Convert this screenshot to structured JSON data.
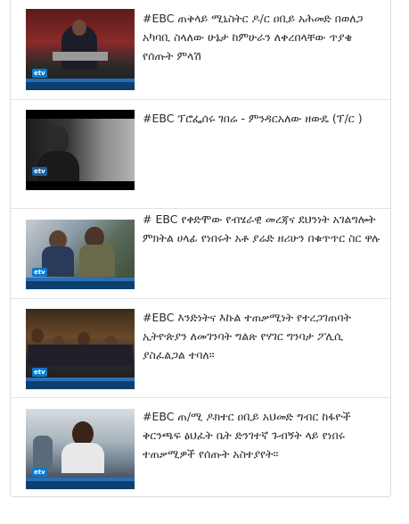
{
  "articles": [
    {
      "title": "#EBC ጠቅላይ ሚኒስትር ዶ/ር ዐቢይ አሕመድ በወለጋ አካባቢ ስላለው ሁኔታ ከምሁራን ለቀረበላቸው ጥያቄ የሰጡት ምላሽ",
      "thumbnail": "pm-press-conference",
      "accent": "#b3262b"
    },
    {
      "title": "#EBC ፕሮፌሰሩ ገበሬ - ምንዳርአለው ዘውዴ (ፕ/ር )",
      "thumbnail": "professor-portrait",
      "accent": "#555555"
    },
    {
      "title": "# EBC የቀድሞው የብሄራዊ መረጃና ደህንነት አገልግሎት ምክትል ሀላፊ የነበሩት አቶ ያሬድ ዘሪሁን በቁጥጥር ስር ዋሉ",
      "thumbnail": "arrest-crowd",
      "accent": "#7a8a6a"
    },
    {
      "title": "#EBC እንድነትና እኩል ተጠቃሚነት የተረጋገጠባት ኢትዮጵያን ለመገንባት ግልጽ የሃገር ግንባታ ፖሊሲ ያስፈልጋል ተባለ።",
      "thumbnail": "conference-hall",
      "accent": "#8a6a3a"
    },
    {
      "title": "#EBC ጠ/ሚ ዶክተር ዐቢይ አህመድ ግብር ከፋዮች ቅርንጫፍ ፅህፈት ቤት ድንገተኛ ጉብኝት ላይ የነበሩ ተጠቃሚዎች የሰጡት አስተያየት።",
      "thumbnail": "interview-woman",
      "accent": "#4a6a9a"
    }
  ],
  "brand": {
    "logo_text": "etv",
    "link_color": "#2b2b2b",
    "border_color": "#dcdcdc"
  }
}
